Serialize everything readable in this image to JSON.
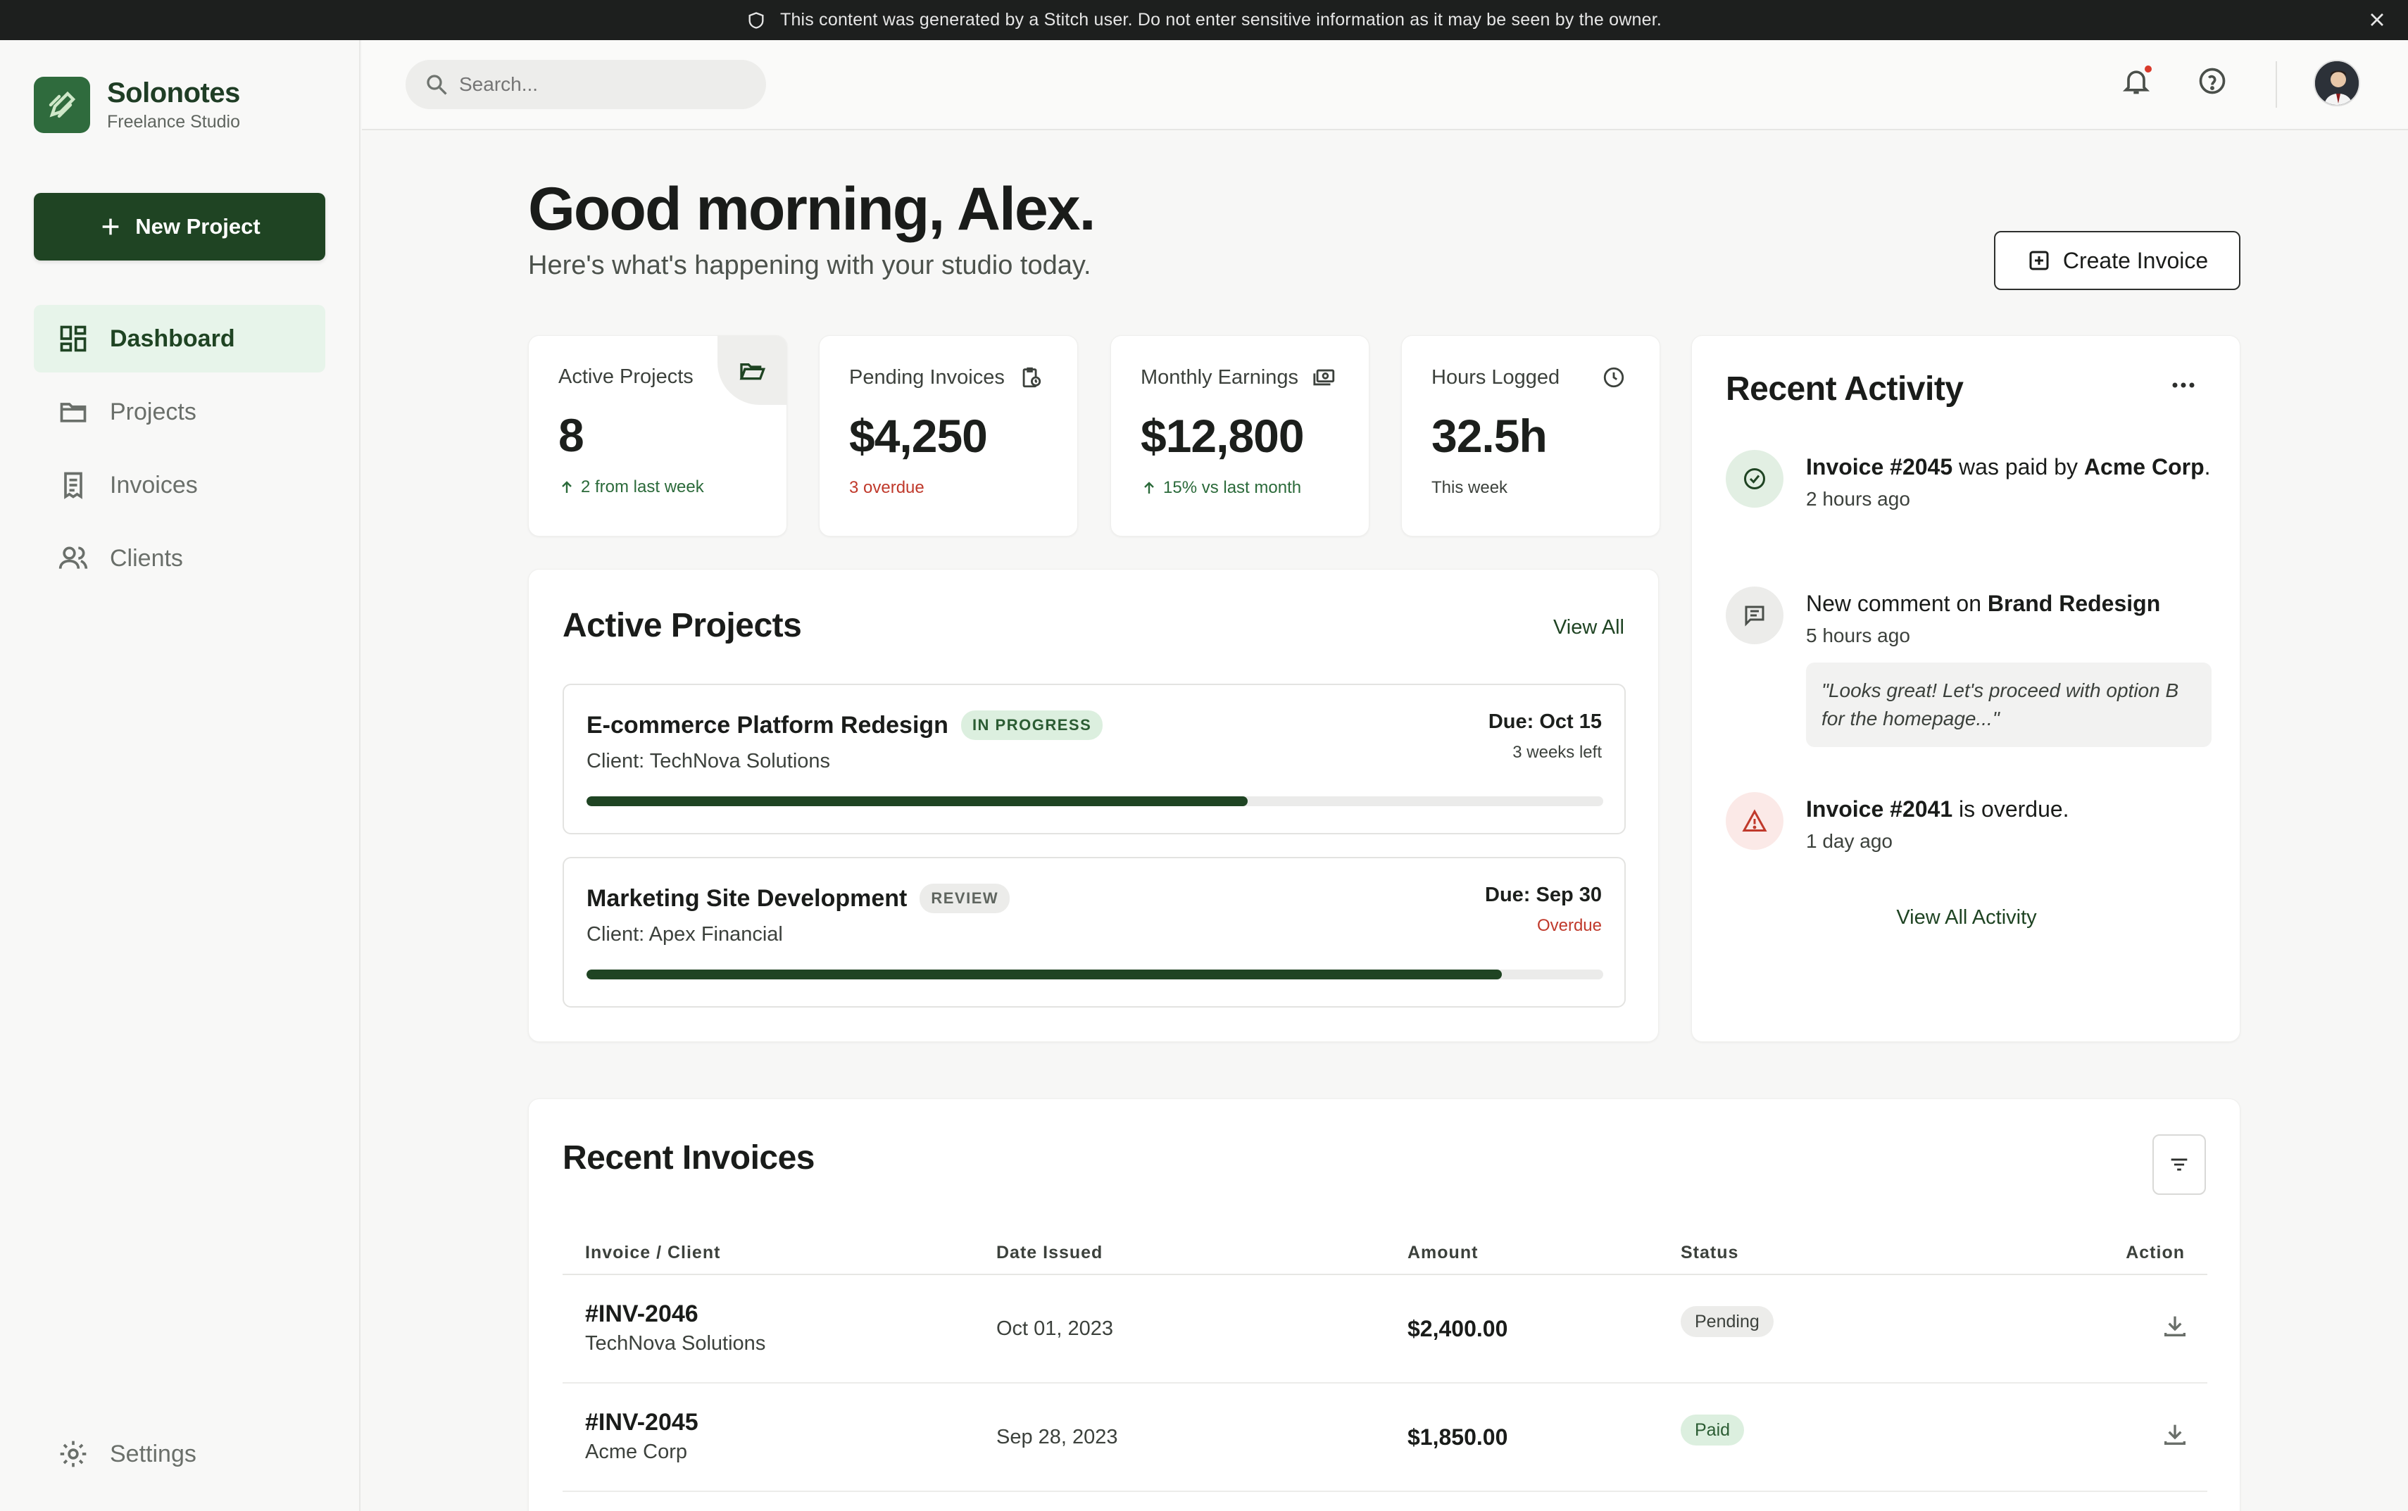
{
  "banner": {
    "text": "This content was generated by a Stitch user. Do not enter sensitive information as it may be seen by the owner."
  },
  "brand": {
    "name": "Solonotes",
    "subtitle": "Freelance Studio"
  },
  "sidebar": {
    "new_project_label": "New Project",
    "items": [
      {
        "label": "Dashboard",
        "icon": "dashboard-icon",
        "active": true
      },
      {
        "label": "Projects",
        "icon": "folder-icon",
        "active": false
      },
      {
        "label": "Invoices",
        "icon": "receipt-icon",
        "active": false
      },
      {
        "label": "Clients",
        "icon": "users-icon",
        "active": false
      }
    ],
    "settings_label": "Settings"
  },
  "header": {
    "search_placeholder": "Search..."
  },
  "greeting": {
    "title": "Good morning, Alex.",
    "subtitle": "Here's what's happening with your studio today."
  },
  "actions": {
    "create_invoice_label": "Create Invoice"
  },
  "stats": [
    {
      "label": "Active Projects",
      "value": "8",
      "sub": "2 from last week",
      "icon": "folder-open-icon"
    },
    {
      "label": "Pending Invoices",
      "value": "$4,250",
      "sub": "3 overdue",
      "icon": "clipboard-clock-icon"
    },
    {
      "label": "Monthly Earnings",
      "value": "$12,800",
      "sub": "15% vs last month",
      "icon": "cash-icon"
    },
    {
      "label": "Hours Logged",
      "value": "32.5h",
      "sub": "This week",
      "icon": "clock-icon"
    }
  ],
  "projects": {
    "title": "Active Projects",
    "view_all": "View All",
    "items": [
      {
        "name": "E-commerce Platform Redesign",
        "status": "IN PROGRESS",
        "client": "Client: TechNova Solutions",
        "due": "Due: Oct 15",
        "remaining": "3 weeks left",
        "progress": 0.65
      },
      {
        "name": "Marketing Site Development",
        "status": "REVIEW",
        "client": "Client: Apex Financial",
        "due": "Due: Sep 30",
        "remaining": "Overdue",
        "progress": 0.9
      }
    ]
  },
  "activity": {
    "title": "Recent Activity",
    "items": [
      {
        "a": "Invoice #2045",
        "b": " was paid by ",
        "c": "Acme Corp",
        "d": ".",
        "time": "2 hours ago",
        "icon": "check-circle-icon"
      },
      {
        "a": "New comment on ",
        "b": "Brand Redesign",
        "time": "5 hours ago",
        "quote": "\"Looks great! Let's proceed with option B for the homepage...\"",
        "icon": "comment-icon"
      },
      {
        "a": "Invoice #2041",
        "b": " is overdue.",
        "time": "1 day ago",
        "icon": "warning-icon"
      }
    ],
    "view_all": "View All Activity"
  },
  "invoices": {
    "title": "Recent Invoices",
    "columns": [
      "Invoice / Client",
      "Date Issued",
      "Amount",
      "Status",
      "Action"
    ],
    "rows": [
      {
        "id": "#INV-2046",
        "client": "TechNova Solutions",
        "date": "Oct 01, 2023",
        "amount": "$2,400.00",
        "status": "Pending"
      },
      {
        "id": "#INV-2045",
        "client": "Acme Corp",
        "date": "Sep 28, 2023",
        "amount": "$1,850.00",
        "status": "Paid"
      }
    ]
  }
}
